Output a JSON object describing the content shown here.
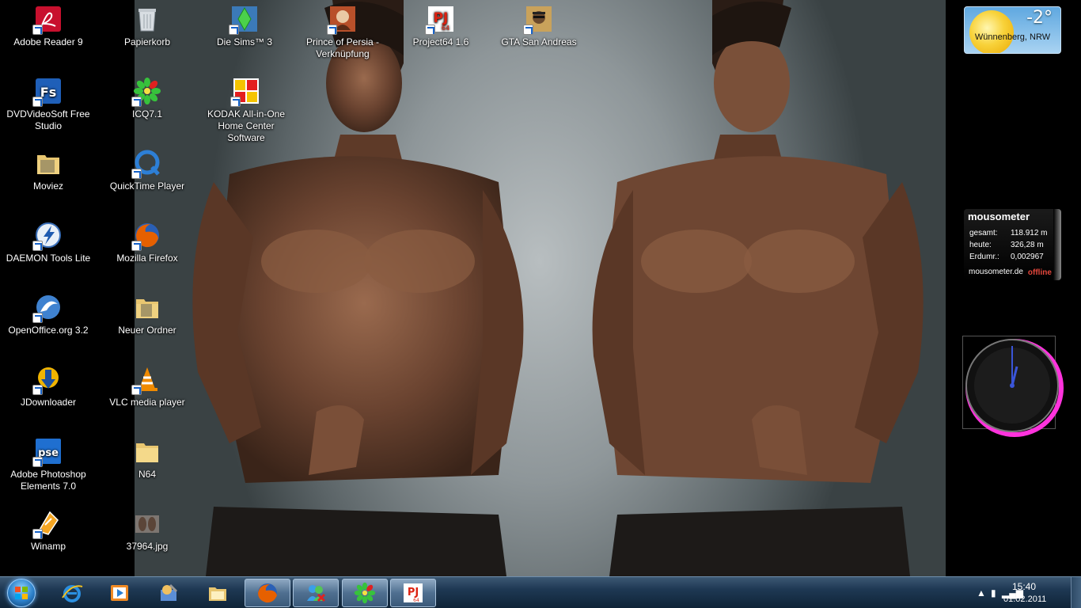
{
  "desktop_icons": [
    {
      "label": "Adobe Reader 9",
      "icon": "adobe-reader-icon"
    },
    {
      "label": "DVDVideoSoft Free Studio",
      "icon": "dvdvideosoft-icon"
    },
    {
      "label": "Moviez",
      "icon": "folder-icon"
    },
    {
      "label": "DAEMON Tools Lite",
      "icon": "daemon-tools-icon"
    },
    {
      "label": "OpenOffice.org 3.2",
      "icon": "openoffice-icon"
    },
    {
      "label": "JDownloader",
      "icon": "jdownloader-icon"
    },
    {
      "label": "Adobe Photoshop Elements 7.0",
      "icon": "photoshop-elements-icon"
    },
    {
      "label": "Winamp",
      "icon": "winamp-icon"
    },
    {
      "label": "Papierkorb",
      "icon": "recycle-bin-icon"
    },
    {
      "label": "ICQ7.1",
      "icon": "icq-icon"
    },
    {
      "label": "QuickTime Player",
      "icon": "quicktime-icon"
    },
    {
      "label": "Mozilla Firefox",
      "icon": "firefox-icon"
    },
    {
      "label": "Neuer Ordner",
      "icon": "folder-icon"
    },
    {
      "label": "VLC media player",
      "icon": "vlc-icon"
    },
    {
      "label": "N64",
      "icon": "folder-icon"
    },
    {
      "label": "37964.jpg",
      "icon": "image-file-icon"
    },
    {
      "label": "Die Sims™ 3",
      "icon": "sims-icon"
    },
    {
      "label": "KODAK All-in-One Home Center Software",
      "icon": "kodak-icon"
    },
    {
      "label": "Prince of Persia - Verknüpfung",
      "icon": "prince-of-persia-icon"
    },
    {
      "label": "Project64 1.6",
      "icon": "project64-icon"
    },
    {
      "label": "GTA San Andreas",
      "icon": "gta-icon"
    }
  ],
  "weather": {
    "temperature": "-2°",
    "location": "Wünnenberg, NRW"
  },
  "mousometer": {
    "title": "mousometer",
    "rows": [
      {
        "key": "gesamt:",
        "value": "118.912 m"
      },
      {
        "key": "heute:",
        "value": "326,28 m"
      },
      {
        "key": "Erdumr.:",
        "value": "0,002967"
      }
    ],
    "site": "mousometer.de",
    "status": "offline ›"
  },
  "taskbar": {
    "pinned": [
      "internet-explorer-icon",
      "media-player-icon",
      "program-icon",
      "explorer-folder-icon",
      "firefox-icon",
      "messenger-icon",
      "icq-icon",
      "project64-icon"
    ],
    "tray": {
      "time": "15:40",
      "date": "01.02.2011"
    }
  }
}
